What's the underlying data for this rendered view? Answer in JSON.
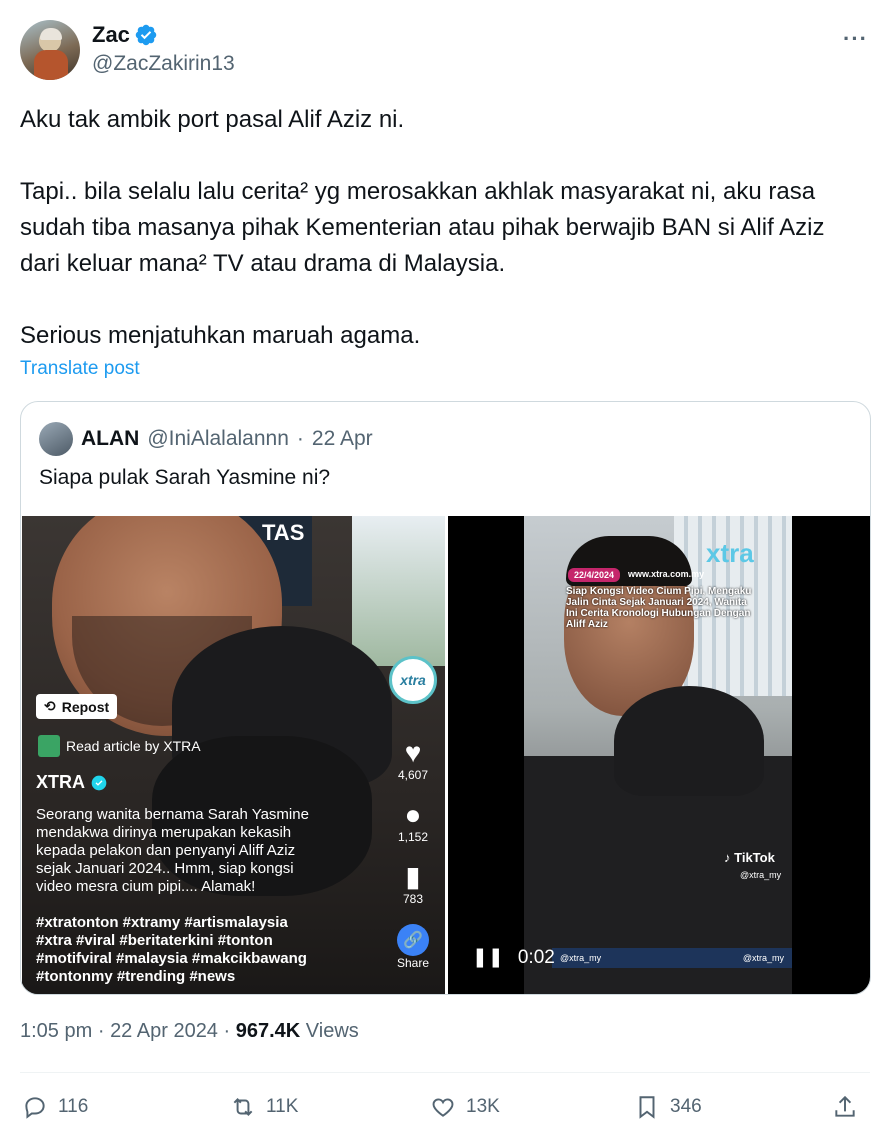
{
  "author": {
    "name": "Zac",
    "handle": "@ZacZakirin13"
  },
  "tweet": {
    "paragraphs": [
      "Aku tak ambik port pasal Alif Aziz ni.",
      "Tapi.. bila selalu lalu cerita² yg merosakkan akhlak masyarakat ni, aku rasa sudah tiba masanya pihak Kementerian atau pihak berwajib BAN si Alif Aziz dari keluar mana² TV atau drama di Malaysia.",
      "Serious menjatuhkan maruah agama."
    ],
    "translate_label": "Translate post"
  },
  "quote": {
    "name": "ALAN",
    "handle": "@IniAlalalannn",
    "separator": "·",
    "date": "22 Apr",
    "text": "Siapa pulak Sarah Yasmine ni?",
    "left_media": {
      "sign_text": "TAS",
      "repost_label": "Repost",
      "read_article_label": "Read article by XTRA",
      "account_name": "XTRA",
      "description": "Seorang wanita bernama Sarah Yasmine\nmendakwa dirinya merupakan kekasih\nkepada pelakon dan penyanyi Aliff Aziz\nsejak Januari 2024.. Hmm, siap kongsi\nvideo mesra cium pipi.... Alamak!",
      "hashtags": "#xtratonton #xtramy #artismalaysia\n#xtra #viral #beritaterkini #tonton\n#motifviral #malaysia #makcikbawang\n#tontonmy #trending #news",
      "logo_text": "xtra",
      "likes": "4,607",
      "comments": "1,152",
      "saves": "783",
      "share_label": "Share"
    },
    "right_media": {
      "brand": "xtra",
      "date_badge": "22/4/2024",
      "site": "www.xtra.com.my",
      "headline": "Siap Kongsi Video Cium Pipi, Mengaku\nJalin Cinta Sejak Januari 2024, Wanita\nIni Cerita Kronologi Hubungan Dengan\nAliff Aziz",
      "tiktok_label": "TikTok",
      "tiktok_handle": "@xtra_my",
      "bar_left": "@xtra_my",
      "bar_right": "@xtra_my",
      "time": "0:02",
      "play_state_icon": "pause-icon"
    }
  },
  "meta": {
    "time": "1:05 pm",
    "date": "22 Apr 2024",
    "separator": "·",
    "views_count": "967.4K",
    "views_label": "Views"
  },
  "actions": {
    "replies": "116",
    "reposts": "11K",
    "likes": "13K",
    "bookmarks": "346"
  },
  "colors": {
    "accent": "#1d9bf0",
    "secondary_text": "#536471",
    "border": "#cfd9de"
  }
}
